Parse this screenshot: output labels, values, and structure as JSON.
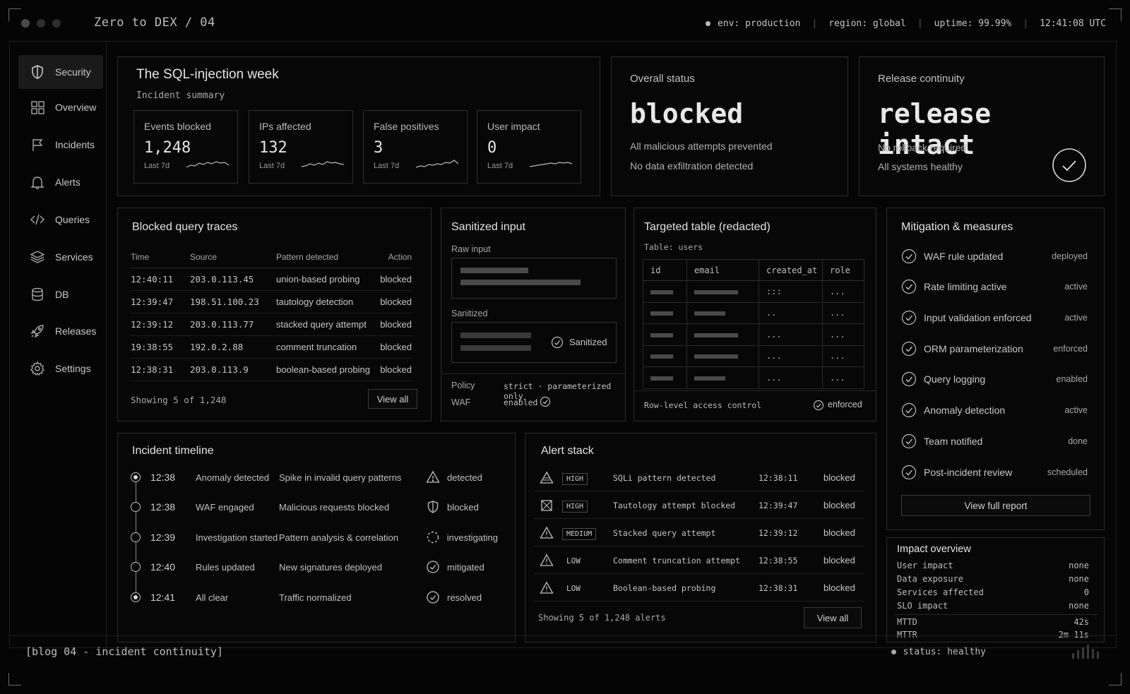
{
  "app": {
    "title": "Zero to DEX / 04"
  },
  "topbar": {
    "env": "env: production",
    "region": "region: global",
    "uptime": "uptime: 99.99%",
    "clock": "12:41:08 UTC"
  },
  "sidebar": {
    "items": [
      {
        "label": "Security",
        "icon": "shield-icon",
        "active": true
      },
      {
        "label": "Overview",
        "icon": "grid-icon"
      },
      {
        "label": "Incidents",
        "icon": "flag-icon"
      },
      {
        "label": "Alerts",
        "icon": "bell-icon"
      },
      {
        "label": "Queries",
        "icon": "code-icon"
      },
      {
        "label": "Services",
        "icon": "layers-icon"
      },
      {
        "label": "DB",
        "icon": "database-icon"
      },
      {
        "label": "Releases",
        "icon": "rocket-icon"
      },
      {
        "label": "Settings",
        "icon": "gear-icon"
      }
    ]
  },
  "summary": {
    "title": "The SQL-injection week",
    "subtitle": "Incident summary",
    "metrics": [
      {
        "label": "Events blocked",
        "value": "1,248",
        "sub": "Last 7d"
      },
      {
        "label": "IPs affected",
        "value": "132",
        "sub": "Last 7d"
      },
      {
        "label": "False positives",
        "value": "3",
        "sub": "Last 7d"
      },
      {
        "label": "User impact",
        "value": "0",
        "sub": "Last 7d"
      }
    ]
  },
  "overall": {
    "title": "Overall status",
    "word": "blocked",
    "line1": "All malicious attempts prevented",
    "line2": "No data exfiltration detected"
  },
  "release": {
    "title": "Release continuity",
    "word": "release intact",
    "line1": "No rollback required",
    "line2": "All systems healthy"
  },
  "traces": {
    "title": "Blocked query traces",
    "columns": [
      "Time",
      "Source",
      "Pattern detected",
      "Action"
    ],
    "rows": [
      [
        "12:40:11",
        "203.0.113.45",
        "union-based probing",
        "blocked"
      ],
      [
        "12:39:47",
        "198.51.100.23",
        "tautology detection",
        "blocked"
      ],
      [
        "12:39:12",
        "203.0.113.77",
        "stacked query attempt",
        "blocked"
      ],
      [
        "19:38:55",
        "192.0.2.88",
        "comment truncation",
        "blocked"
      ],
      [
        "12:38:31",
        "203.0.113.9",
        "boolean-based probing",
        "blocked"
      ]
    ],
    "showing": "Showing 5 of 1,248",
    "view_all": "View all"
  },
  "sanitized": {
    "title": "Sanitized input",
    "raw_label": "Raw input",
    "san_label": "Sanitized",
    "badge": "Sanitized",
    "policy_label": "Policy",
    "policy_value": "strict · parameterized only",
    "waf_label": "WAF",
    "waf_value": "enabled"
  },
  "targeted": {
    "title": "Targeted table (redacted)",
    "subtitle": "Table: users",
    "columns": [
      "id",
      "email",
      "created_at",
      "role"
    ],
    "rows": [
      [
        ":::",
        "..."
      ],
      [
        "..",
        "..."
      ],
      [
        "...",
        "..."
      ],
      [
        "...",
        "..."
      ],
      [
        "...",
        "..."
      ]
    ],
    "footer_label": "Row-level access control",
    "footer_value": "enforced"
  },
  "mitigation": {
    "title": "Mitigation & measures",
    "items": [
      {
        "label": "WAF rule updated",
        "status": "deployed"
      },
      {
        "label": "Rate limiting active",
        "status": "active"
      },
      {
        "label": "Input validation enforced",
        "status": "active"
      },
      {
        "label": "ORM parameterization",
        "status": "enforced"
      },
      {
        "label": "Query logging",
        "status": "enabled"
      },
      {
        "label": "Anomaly detection",
        "status": "active"
      },
      {
        "label": "Team notified",
        "status": "done"
      },
      {
        "label": "Post-incident review",
        "status": "scheduled"
      }
    ],
    "button": "View full report"
  },
  "impact": {
    "title": "Impact overview",
    "rows": [
      {
        "label": "User impact",
        "value": "none"
      },
      {
        "label": "Data exposure",
        "value": "none"
      },
      {
        "label": "Services affected",
        "value": "0"
      },
      {
        "label": "SLO impact",
        "value": "none"
      }
    ],
    "mttd_label": "MTTD",
    "mttd_value": "42s",
    "mttr_label": "MTTR",
    "mttr_value": "2m 11s"
  },
  "timeline": {
    "title": "Incident timeline",
    "rows": [
      {
        "time": "12:38",
        "event": "Anomaly detected",
        "desc": "Spike in invalid query patterns",
        "status": "detected",
        "icon": "warning-icon"
      },
      {
        "time": "12:38",
        "event": "WAF engaged",
        "desc": "Malicious requests blocked",
        "status": "blocked",
        "icon": "shield-icon"
      },
      {
        "time": "12:39",
        "event": "Investigation started",
        "desc": "Pattern analysis & correlation",
        "status": "investigating",
        "icon": "spinner-icon"
      },
      {
        "time": "12:40",
        "event": "Rules updated",
        "desc": "New signatures deployed",
        "status": "mitigated",
        "icon": "check-circle-icon"
      },
      {
        "time": "12:41",
        "event": "All clear",
        "desc": "Traffic normalized",
        "status": "resolved",
        "icon": "check-circle-icon"
      }
    ]
  },
  "alerts": {
    "title": "Alert stack",
    "rows": [
      {
        "severity": "HIGH",
        "message": "SQLi pattern detected",
        "time": "12:38:11",
        "action": "blocked"
      },
      {
        "severity": "HIGH",
        "message": "Tautology attempt blocked",
        "time": "12:39:47",
        "action": "blocked"
      },
      {
        "severity": "MEDIUM",
        "message": "Stacked query attempt",
        "time": "12:39:12",
        "action": "blocked"
      },
      {
        "severity": "LOW",
        "message": "Comment truncation attempt",
        "time": "12:38:55",
        "action": "blocked"
      },
      {
        "severity": "LOW",
        "message": "Boolean-based probing",
        "time": "12:38:31",
        "action": "blocked"
      }
    ],
    "showing": "Showing 5 of 1,248 alerts",
    "view_all": "View all"
  },
  "footer": {
    "label": "[blog 04 - incident continuity]",
    "status": "status: healthy"
  }
}
